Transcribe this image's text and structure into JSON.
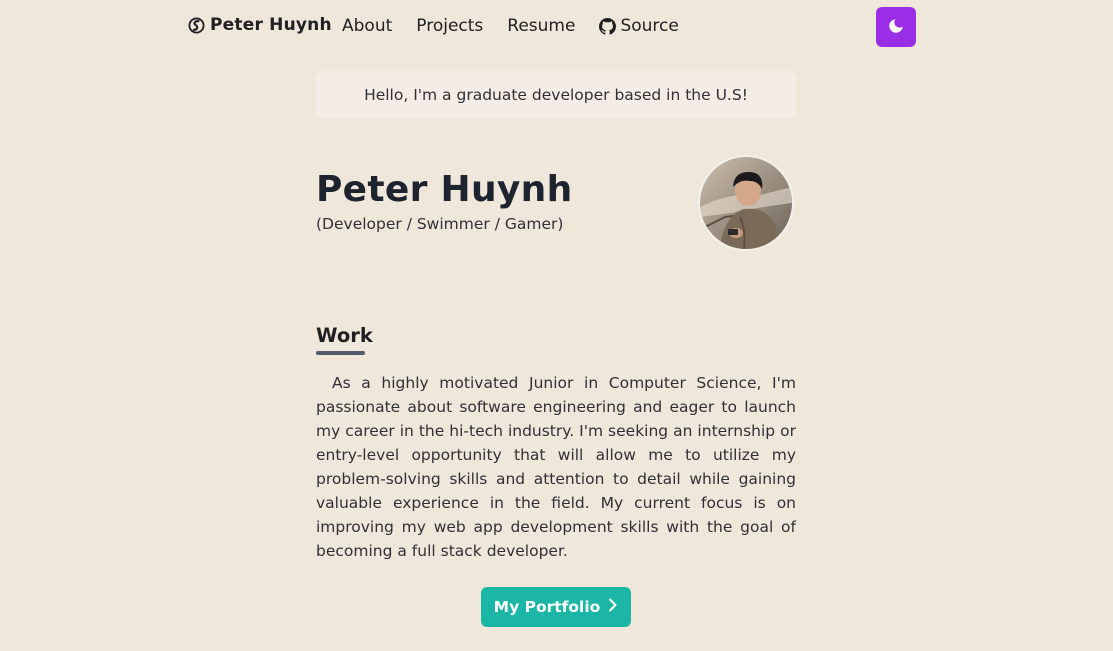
{
  "nav": {
    "brand": "Peter Huynh",
    "links": {
      "about": "About",
      "projects": "Projects",
      "resume": "Resume",
      "source": "Source"
    },
    "theme_toggle_icon": "moon-icon"
  },
  "intro": "Hello, I'm a graduate developer based in the U.S!",
  "profile": {
    "name": "Peter Huynh",
    "roles": "(Developer / Swimmer / Gamer)"
  },
  "work": {
    "heading": "Work",
    "paragraph": "As a highly motivated Junior in Computer Science, I'm passionate about software engineering and eager to launch my career in the hi-tech industry. I'm seeking an internship or entry-level opportunity that will allow me to utilize my problem-solving skills and attention to detail while gaining valuable experience in the field. My current focus is on improving my web app development skills with the goal of becoming a full stack developer.",
    "button_label": "My Portfolio"
  },
  "colors": {
    "background": "#f0e7db",
    "accent_purple": "#9a2ee6",
    "accent_teal": "#1bb6a5"
  }
}
